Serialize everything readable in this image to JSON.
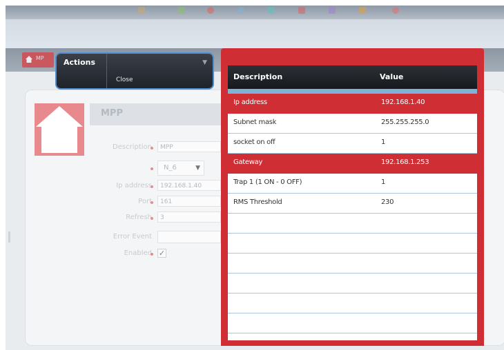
{
  "colors": {
    "accent_red": "#cf2e34",
    "header_dark": "#1f232a",
    "focus_blue": "#4f8ed0"
  },
  "nav": {
    "home_label": "MP"
  },
  "form": {
    "title": "MPP",
    "fields": [
      {
        "label": "Description",
        "value": "MPP"
      },
      {
        "label": "",
        "value": "N_6"
      },
      {
        "label": "Ip address",
        "value": "192.168.1.40"
      },
      {
        "label": "Port",
        "value": "161"
      },
      {
        "label": "Refresh",
        "value": "3"
      },
      {
        "label": "Error Event",
        "value": ""
      },
      {
        "label": "Enabled",
        "value": "✓"
      }
    ]
  },
  "actions_menu": {
    "title": "Actions",
    "close_label": "Close"
  },
  "table": {
    "columns": [
      "Description",
      "Value"
    ],
    "rows": [
      {
        "description": "Ip address",
        "value": "192.168.1.40",
        "selected": true
      },
      {
        "description": "Subnet mask",
        "value": "255.255.255.0",
        "selected": false
      },
      {
        "description": "socket on off",
        "value": "1",
        "selected": false
      },
      {
        "description": "Gateway",
        "value": "192.168.1.253",
        "selected": true
      },
      {
        "description": "Trap 1 (1 ON - 0 OFF)",
        "value": "1",
        "selected": false
      },
      {
        "description": "RMS Threshold",
        "value": "230",
        "selected": false
      },
      {
        "description": "",
        "value": "",
        "selected": false
      },
      {
        "description": "",
        "value": "",
        "selected": false
      },
      {
        "description": "",
        "value": "",
        "selected": false
      },
      {
        "description": "",
        "value": "",
        "selected": false
      },
      {
        "description": "",
        "value": "",
        "selected": false
      },
      {
        "description": "",
        "value": "",
        "selected": false
      }
    ]
  }
}
